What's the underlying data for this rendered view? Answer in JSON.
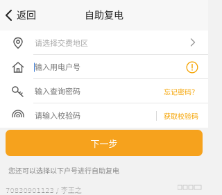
{
  "nav": {
    "back_label": "返回",
    "title": "自助复电"
  },
  "form": {
    "region_placeholder": "请选择交费地区",
    "account_placeholder": "输入用电户号",
    "password_placeholder": "输入查询密码",
    "forgot_password_label": "忘记密码？",
    "captcha_placeholder": "请输入校验码",
    "get_captcha_label": "获取校验码"
  },
  "next_button_label": "下一步",
  "hint_text": "您还可以选择以下户号进行自助复电",
  "saved_account_partial": "70830901123 / 李王之",
  "colors": {
    "accent": "#f6a21d",
    "link": "#f5a300",
    "background": "#f2f2f2"
  },
  "icons": [
    "back-chevron-icon",
    "location-pin-icon",
    "house-icon",
    "key-icon",
    "signal-icon",
    "chevron-right-icon",
    "warning-circle-icon"
  ]
}
